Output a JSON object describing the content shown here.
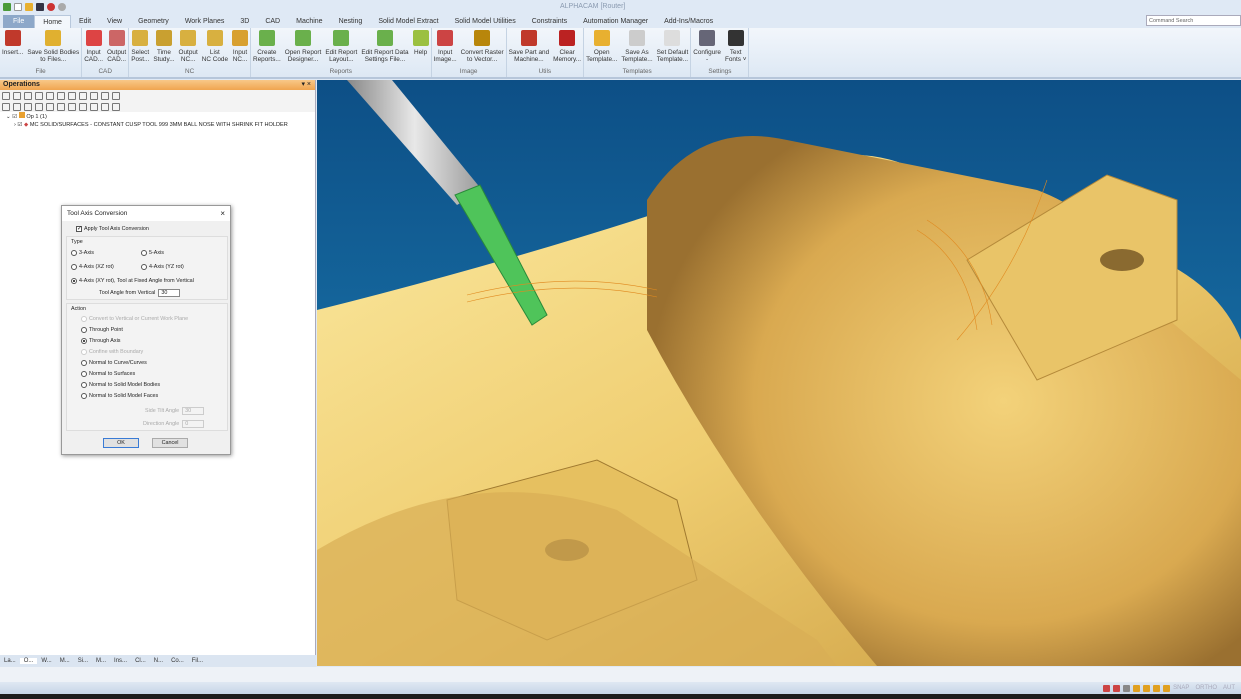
{
  "app": {
    "title": "ALPHACAM [Router]"
  },
  "quick_access": [
    "app-icon",
    "new-icon",
    "open-icon",
    "save-icon",
    "undo-icon",
    "redo-icon"
  ],
  "tabs": [
    "File",
    "Home",
    "Edit",
    "View",
    "Geometry",
    "Work Planes",
    "3D",
    "CAD",
    "Machine",
    "Nesting",
    "Solid Model Extract",
    "Solid Model Utilities",
    "Constraints",
    "Automation Manager",
    "Add-Ins/Macros"
  ],
  "active_tab": "Home",
  "command_search": {
    "placeholder": "Command Search"
  },
  "ribbon": [
    {
      "label": "File",
      "buttons": [
        {
          "l1": "Insert...",
          "l2": "",
          "c": "#c0392b"
        },
        {
          "l1": "Save Solid Bodies",
          "l2": "to Files...",
          "c": "#e0b030"
        }
      ]
    },
    {
      "label": "CAD",
      "buttons": [
        {
          "l1": "Input",
          "l2": "CAD...",
          "c": "#d44"
        },
        {
          "l1": "Output",
          "l2": "CAD...",
          "c": "#c66"
        }
      ]
    },
    {
      "label": "NC",
      "buttons": [
        {
          "l1": "Select",
          "l2": "Post...",
          "c": "#d8b040"
        },
        {
          "l1": "Time",
          "l2": "Study...",
          "c": "#c9a030"
        },
        {
          "l1": "Output",
          "l2": "NC...",
          "c": "#d8b040"
        },
        {
          "l1": "List",
          "l2": "NC Code",
          "c": "#d8b040"
        },
        {
          "l1": "Input",
          "l2": "NC...",
          "c": "#d8a030"
        }
      ]
    },
    {
      "label": "Reports",
      "buttons": [
        {
          "l1": "Create",
          "l2": "Reports...",
          "c": "#6ab04c"
        },
        {
          "l1": "Open Report",
          "l2": "Designer...",
          "c": "#6ab04c"
        },
        {
          "l1": "Edit Report",
          "l2": "Layout...",
          "c": "#6ab04c"
        },
        {
          "l1": "Edit Report Data",
          "l2": "Settings File...",
          "c": "#6ab04c"
        },
        {
          "l1": "Help",
          "l2": "",
          "c": "#9bc040"
        }
      ]
    },
    {
      "label": "Image",
      "buttons": [
        {
          "l1": "Input",
          "l2": "Image...",
          "c": "#c44"
        },
        {
          "l1": "Convert Raster",
          "l2": "to Vector...",
          "c": "#b8860b"
        }
      ]
    },
    {
      "label": "Utils",
      "buttons": [
        {
          "l1": "Save Part and",
          "l2": "Machine...",
          "c": "#c0392b"
        },
        {
          "l1": "Clear",
          "l2": "Memory...",
          "c": "#b22"
        }
      ]
    },
    {
      "label": "Templates",
      "buttons": [
        {
          "l1": "Open",
          "l2": "Template...",
          "c": "#e8b030"
        },
        {
          "l1": "Save As",
          "l2": "Template...",
          "c": "#ccc"
        },
        {
          "l1": "Set Default",
          "l2": "Template...",
          "c": "#ddd"
        }
      ]
    },
    {
      "label": "Settings",
      "buttons": [
        {
          "l1": "Configure",
          "l2": "-",
          "c": "#667"
        },
        {
          "l1": "Text",
          "l2": "Fonts ˅",
          "c": "#333"
        }
      ]
    }
  ],
  "operations": {
    "title": "Operations",
    "controls": "▾ ×",
    "tree": [
      {
        "label": "Op 1  (1)"
      },
      {
        "label": "MC SOLID/SURFACES - CONSTANT CUSP   TOOL 999   3MM BALL NOSE WITH SHRINK FIT HOLDER"
      }
    ],
    "bottom_tabs": [
      "La...",
      "O...",
      "W...",
      "M...",
      "Si...",
      "M...",
      "Ins...",
      "Cl...",
      "N...",
      "Co...",
      "Fil..."
    ]
  },
  "dialog": {
    "title": "Tool Axis Conversion",
    "apply_label": "Apply Tool Axis Conversion",
    "apply_checked": true,
    "type_label": "Type",
    "type_options": [
      "3-Axis",
      "5-Axis",
      "4-Axis (XZ rot)",
      "4-Axis (YZ rot)",
      "4-Axis (XY rot), Tool at Fixed Angle from Vertical"
    ],
    "type_selected": "4-Axis (XY rot), Tool at Fixed Angle from Vertical",
    "tool_angle_label": "Tool Angle from Vertical",
    "tool_angle": "30",
    "action_label": "Action",
    "action_options": [
      "Convert to Vertical or Current Work Plane",
      "Through Point",
      "Through Axis",
      "Confine with Boundary",
      "Normal to Curve/Curves",
      "Normal to Surfaces",
      "Normal to Solid Model Bodies",
      "Normal to Solid Model Faces"
    ],
    "action_selected": "Through Axis",
    "side_tilt_label": "Side Tilt Angle",
    "side_tilt": "30",
    "direction_label": "Direction Angle",
    "direction": "0",
    "ok": "OK",
    "cancel": "Cancel"
  },
  "status": {
    "snap": "SNAP",
    "ortho": "ORTHO",
    "auto": "AUT"
  },
  "colors": {
    "viewport_bg": "#1a6fa3",
    "part": "#e8c466",
    "tool": "#4fc45a",
    "accent": "#f0a550"
  }
}
